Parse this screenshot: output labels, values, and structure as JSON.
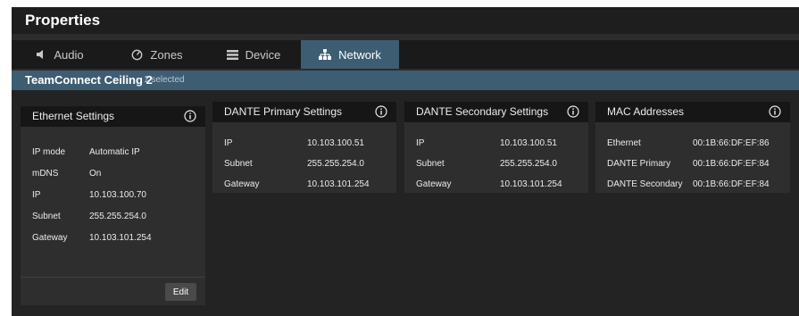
{
  "window": {
    "title": "Properties"
  },
  "tabs": [
    {
      "label": "Audio",
      "icon": "speaker-icon",
      "active": false
    },
    {
      "label": "Zones",
      "icon": "zones-dial-icon",
      "active": false
    },
    {
      "label": "Device",
      "icon": "device-list-icon",
      "active": false
    },
    {
      "label": "Network",
      "icon": "network-icon",
      "active": true
    }
  ],
  "selection": {
    "device_name": "TeamConnect Ceiling 2",
    "count_label": "1 selected"
  },
  "ethernet": {
    "title": "Ethernet Settings",
    "rows": [
      {
        "label": "IP mode",
        "value": "Automatic IP"
      },
      {
        "label": "mDNS",
        "value": "On"
      },
      {
        "label": "IP",
        "value": "10.103.100.70"
      },
      {
        "label": "Subnet",
        "value": "255.255.254.0"
      },
      {
        "label": "Gateway",
        "value": "10.103.101.254"
      }
    ],
    "edit_label": "Edit"
  },
  "dante_primary": {
    "title": "DANTE Primary Settings",
    "rows": [
      {
        "label": "IP",
        "value": "10.103.100.51"
      },
      {
        "label": "Subnet",
        "value": "255.255.254.0"
      },
      {
        "label": "Gateway",
        "value": "10.103.101.254"
      }
    ]
  },
  "dante_secondary": {
    "title": "DANTE Secondary Settings",
    "rows": [
      {
        "label": "IP",
        "value": "10.103.100.51"
      },
      {
        "label": "Subnet",
        "value": "255.255.254.0"
      },
      {
        "label": "Gateway",
        "value": "10.103.101.254"
      }
    ]
  },
  "mac": {
    "title": "MAC Addresses",
    "rows": [
      {
        "label": "Ethernet",
        "value": "00:1B:66:DF:EF:86"
      },
      {
        "label": "DANTE Primary",
        "value": "00:1B:66:DF:EF:84"
      },
      {
        "label": "DANTE Secondary",
        "value": "00:1B:66:DF:EF:84"
      }
    ]
  },
  "colors": {
    "accent": "#3d5d73",
    "panel": "#2e2e2e",
    "panel_header": "#161616",
    "background": "#232323"
  }
}
